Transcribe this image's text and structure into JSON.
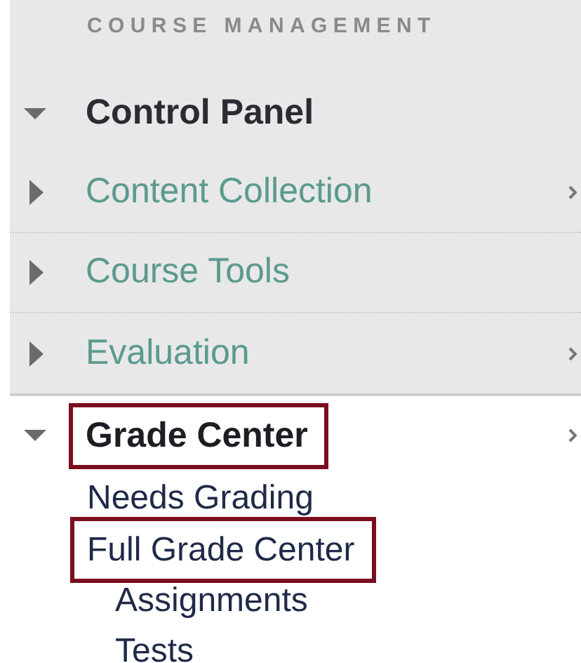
{
  "header": "COURSE MANAGEMENT",
  "panel": [
    {
      "kind": "heading",
      "label": "Control Panel",
      "expanded": true,
      "submenu": false
    },
    {
      "kind": "tool",
      "label": "Content Collection",
      "expanded": false,
      "submenu": true
    },
    {
      "kind": "tool",
      "label": "Course Tools",
      "expanded": false,
      "submenu": false
    },
    {
      "kind": "tool",
      "label": "Evaluation",
      "expanded": false,
      "submenu": true
    }
  ],
  "menu": [
    {
      "kind": "heading",
      "label": "Grade Center",
      "expanded": true,
      "submenu": true,
      "highlighted": true
    },
    {
      "kind": "sub",
      "label": "Needs Grading",
      "highlighted": false
    },
    {
      "kind": "sub",
      "label": "Full Grade Center",
      "highlighted": true
    },
    {
      "kind": "subsub",
      "label": "Assignments",
      "highlighted": false
    },
    {
      "kind": "subsub",
      "label": "Tests",
      "highlighted": false
    }
  ]
}
